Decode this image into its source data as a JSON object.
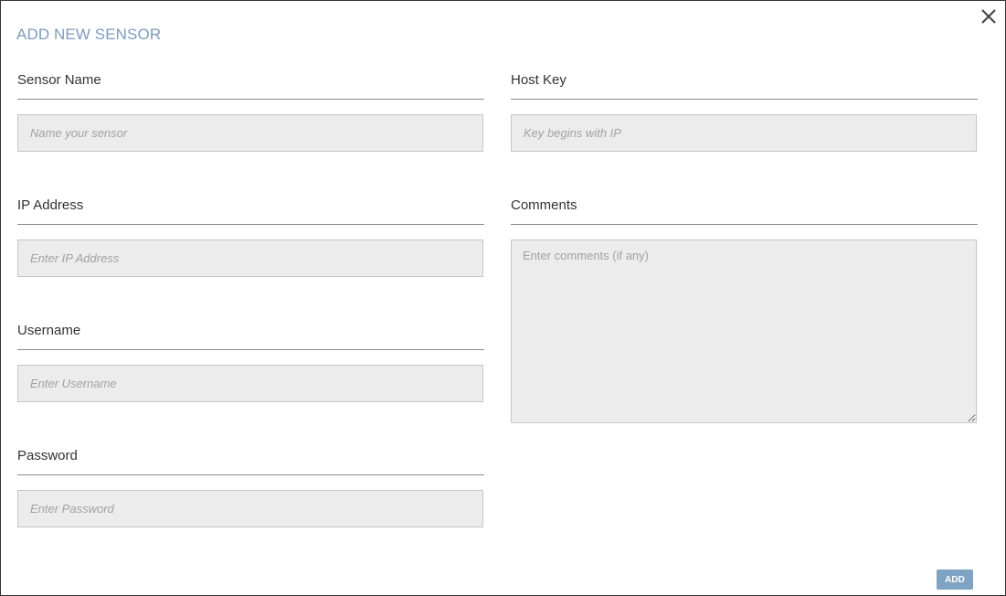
{
  "dialog": {
    "title": "ADD NEW SENSOR",
    "close_icon": "close-icon"
  },
  "fields": {
    "sensor_name": {
      "label": "Sensor Name",
      "placeholder": "Name your sensor",
      "value": ""
    },
    "ip_address": {
      "label": "IP Address",
      "placeholder": "Enter IP Address",
      "value": ""
    },
    "username": {
      "label": "Username",
      "placeholder": "Enter Username",
      "value": ""
    },
    "password": {
      "label": "Password",
      "placeholder": "Enter Password",
      "value": ""
    },
    "host_key": {
      "label": "Host Key",
      "placeholder": "Key begins with IP",
      "value": ""
    },
    "comments": {
      "label": "Comments",
      "placeholder": "Enter comments (if any)",
      "value": ""
    }
  },
  "actions": {
    "add_label": "ADD"
  },
  "colors": {
    "title": "#7d9bbd",
    "button": "#7fa3c3",
    "input_bg": "#ececec"
  }
}
